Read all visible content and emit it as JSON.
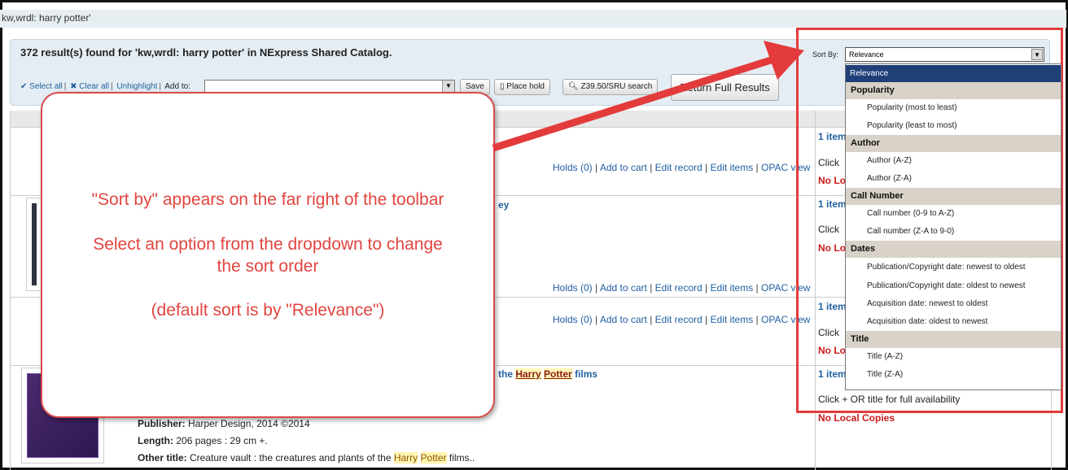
{
  "breadcrumb": "kw,wrdl: harry potter'",
  "results": {
    "heading": "372 result(s) found for 'kw,wrdl: harry potter' in NExpress Shared Catalog."
  },
  "toolbar": {
    "select_all": "✔ Select all",
    "clear_all": "✖ Clear all",
    "unhighlight": "Unhighlight",
    "add_to_label": "Add to:",
    "add_to_value": "",
    "save": "Save",
    "place_hold": "Place hold",
    "z3950": "Z39.50/SRU search",
    "return_full": "Return Full Results",
    "sort_by_label": "Sort By:",
    "sort_by_value": "Relevance"
  },
  "sort_dropdown": [
    {
      "kind": "selected",
      "label": "Relevance"
    },
    {
      "kind": "group",
      "label": "Popularity"
    },
    {
      "kind": "option",
      "label": "Popularity (most to least)"
    },
    {
      "kind": "option",
      "label": "Popularity (least to most)"
    },
    {
      "kind": "group",
      "label": "Author"
    },
    {
      "kind": "option",
      "label": "Author (A-Z)"
    },
    {
      "kind": "option",
      "label": "Author (Z-A)"
    },
    {
      "kind": "group",
      "label": "Call Number"
    },
    {
      "kind": "option",
      "label": "Call number (0-9 to A-Z)"
    },
    {
      "kind": "option",
      "label": "Call number (Z-A to 9-0)"
    },
    {
      "kind": "group",
      "label": "Dates"
    },
    {
      "kind": "option",
      "label": "Publication/Copyright date: newest to oldest"
    },
    {
      "kind": "option",
      "label": "Publication/Copyright date: oldest to newest"
    },
    {
      "kind": "option",
      "label": "Acquisition date: newest to oldest"
    },
    {
      "kind": "option",
      "label": "Acquisition date: oldest to newest"
    },
    {
      "kind": "group",
      "label": "Title"
    },
    {
      "kind": "option",
      "label": "Title (A-Z)"
    },
    {
      "kind": "option",
      "label": "Title (Z-A)"
    }
  ],
  "row_actions": {
    "holds": "Holds (0)",
    "add_to_cart": "Add to cart",
    "edit_record": "Edit record",
    "edit_items": "Edit items",
    "opac_view": "OPAC view"
  },
  "availability": {
    "items_prefix": "1 item",
    "click_prefix": "Click",
    "no_local_prefix": "No Lo",
    "click_full": "Click + OR title for full availability",
    "no_local_full": "No Local Copies"
  },
  "record4": {
    "title_prefix": "the",
    "title_hl1": "Harry",
    "title_hl2": "Potter",
    "title_suffix": "films",
    "publisher_label": "Publisher:",
    "publisher_value": "Harper Design, 2014 ©2014",
    "length_label": "Length:",
    "length_value": "206 pages : 29 cm +.",
    "other_title_label": "Other title:",
    "other_title_pre": "Creature vault : the creatures and plants of the",
    "other_title_hl1": "Harry",
    "other_title_hl2": "Potter",
    "other_title_post": "films.."
  },
  "record2": {
    "title_tail": "ey"
  },
  "callout": {
    "line1": "\"Sort by\" appears on the far right of the toolbar",
    "line2": "Select an option from the dropdown to change",
    "line3": "the sort order",
    "line4": "(default sort is by \"Relevance\")"
  },
  "colors": {
    "annotation_red": "#e33b3b",
    "link_blue": "#1f5f9f",
    "selected_option_bg": "#1e3f78",
    "group_header_bg": "#d8d2c8"
  }
}
